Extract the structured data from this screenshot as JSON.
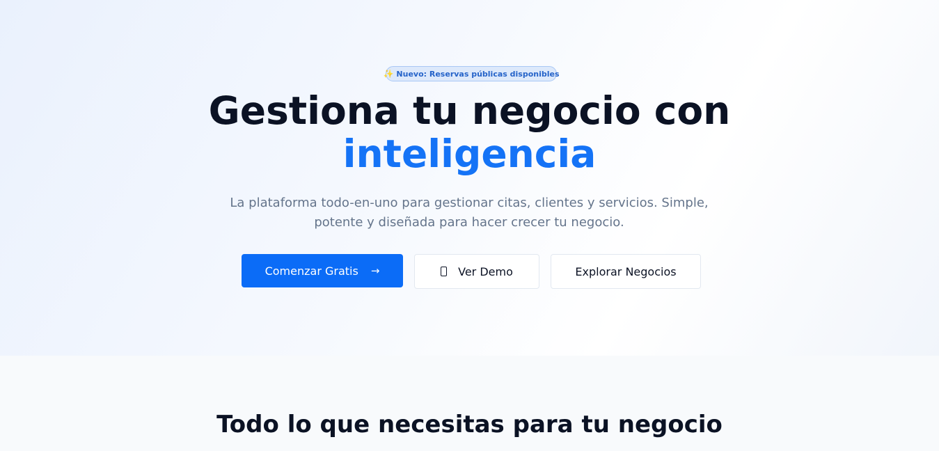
{
  "hero": {
    "badge": {
      "icon": "sparkles-icon",
      "text": "Nuevo: Reservas públicas disponibles"
    },
    "title_line1": "Gestiona tu negocio con",
    "title_line2": "inteligencia",
    "subtitle": "La plataforma todo-en-uno para gestionar citas, clientes y servicios. Simple, potente y diseñada para hacer crecer tu negocio.",
    "buttons": {
      "primary_label": "Comenzar Gratis",
      "primary_icon": "arrow-right-icon",
      "demo_label": "Ver Demo",
      "demo_icon": "smartphone-icon",
      "explore_label": "Explorar Negocios"
    }
  },
  "features": {
    "title": "Todo lo que necesitas para tu negocio"
  },
  "colors": {
    "accent": "#1573f6",
    "primary_button": "#0b6cf7",
    "heading": "#0b1224",
    "muted_text": "#64748b"
  }
}
